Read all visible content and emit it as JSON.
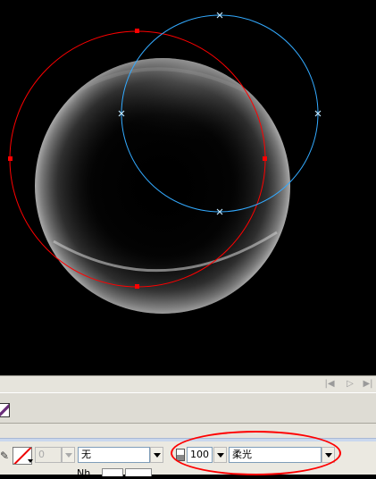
{
  "canvas": {
    "background": "#000000",
    "red_path_color": "#ff0000",
    "blue_path_color": "#33aaff"
  },
  "timeline": {
    "icons": [
      "step-back-icon",
      "play-icon",
      "step-forward-icon"
    ]
  },
  "properties": {
    "stroke_weight": "0",
    "stroke_style": "无",
    "alpha": "100",
    "blend_mode": "柔光",
    "extra_label": "Nh"
  },
  "annotation": {
    "highlight_color": "#ff0000"
  }
}
